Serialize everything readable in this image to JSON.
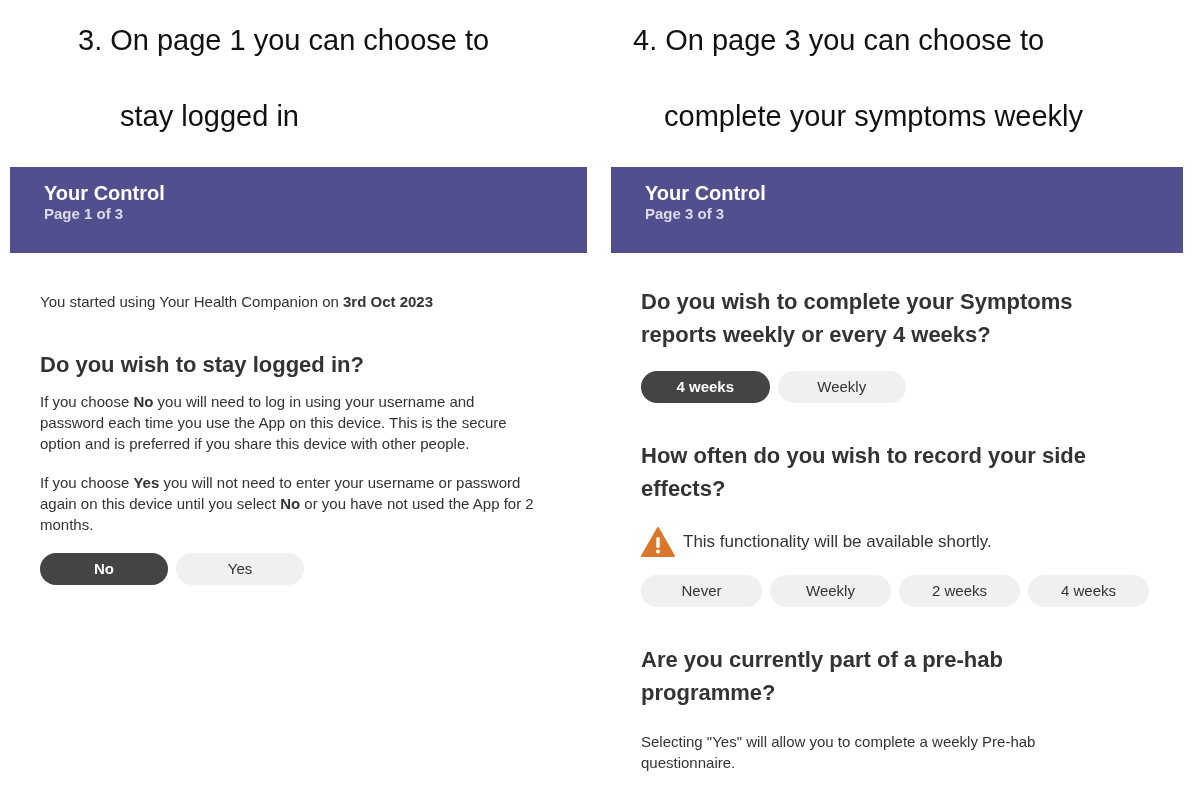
{
  "panels": [
    {
      "caption": [
        "3. On page 1 you can choose to",
        "stay logged in"
      ],
      "header": {
        "title": "Your Control",
        "subtitle": "Page 1 of 3"
      },
      "blocks": [
        {
          "kind": "text",
          "text": "You started using Your Health Companion on **3rd Oct 2023**"
        },
        {
          "kind": "heading",
          "text": "Do you wish to stay logged in?"
        },
        {
          "kind": "text",
          "text": "If you choose **No** you will need to log in using your username and password each time you use the App on this device. This is the secure option and is preferred if you share this device with other people."
        },
        {
          "kind": "text",
          "text": "If you choose **Yes** you will not need to enter your username or password again on this device until you select **No** or you have not used the App for 2 months."
        },
        {
          "kind": "options",
          "options": [
            {
              "label": "No",
              "selected": true
            },
            {
              "label": "Yes",
              "selected": false
            }
          ]
        }
      ]
    },
    {
      "caption": [
        "4. On page 3 you can choose to",
        "complete your symptoms weekly"
      ],
      "header": {
        "title": "Your Control",
        "subtitle": "Page 3 of 3"
      },
      "blocks": [
        {
          "kind": "heading",
          "text": "Do you wish to complete your Symptoms reports weekly or every 4 weeks?"
        },
        {
          "kind": "options",
          "options": [
            {
              "label": "4 weeks",
              "selected": true
            },
            {
              "label": "Weekly",
              "selected": false
            }
          ]
        },
        {
          "kind": "heading",
          "text": "How often do you wish to record your side effects?"
        },
        {
          "kind": "warning",
          "text": "This functionality will be available shortly."
        },
        {
          "kind": "options",
          "options": [
            {
              "label": "Never",
              "selected": false
            },
            {
              "label": "Weekly",
              "selected": false
            },
            {
              "label": "2 weeks",
              "selected": false
            },
            {
              "label": "4 weeks",
              "selected": false
            }
          ]
        },
        {
          "kind": "heading",
          "text": "Are you currently part of a pre-hab programme?"
        },
        {
          "kind": "text",
          "text": "Selecting \"Yes\" will allow you to complete a weekly Pre-hab questionnaire."
        }
      ]
    }
  ]
}
